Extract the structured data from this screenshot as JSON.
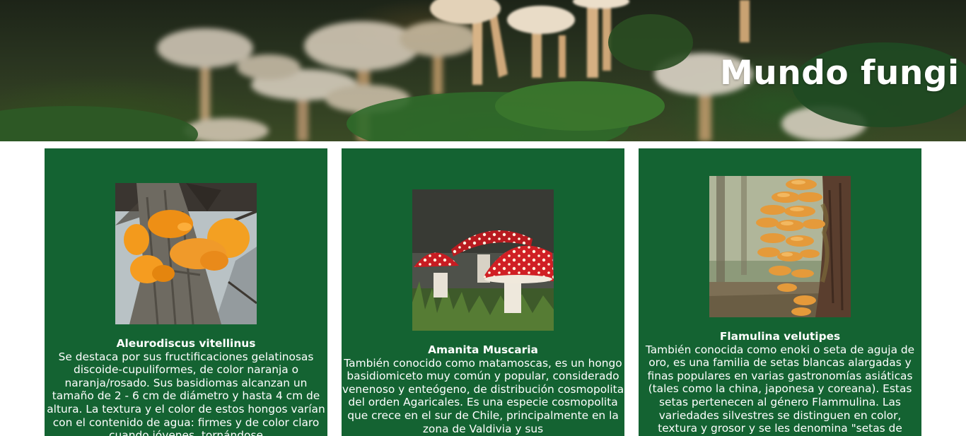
{
  "header": {
    "title": "Mundo fungi",
    "background_icon": "mushroom-forest-photo"
  },
  "colors": {
    "card_background": "#146332",
    "card_text": "#ffffff",
    "page_background": "#ffffff"
  },
  "cards": [
    {
      "title": "Aleurodiscus vitellinus",
      "image_icon": "orange-jelly-fungus-photo",
      "description": "Se destaca por sus fructificaciones gelatinosas discoide-cupuliformes, de color naranja o naranja/rosado. Sus basidiomas alcanzan un tamaño de 2 - 6 cm de diámetro y hasta 4 cm de altura. La textura y el color de estos hongos varían con el contenido de agua: firmes y de color claro cuando jóvenes, tornándose"
    },
    {
      "title": "Amanita Muscaria",
      "image_icon": "red-spotted-mushroom-photo",
      "description": "También conocido como matamoscas, es un hongo basidiomiceto muy común y popular, considerado venenoso y enteógeno, de distribución cosmopolita del orden Agaricales. Es una especie cosmopolita que crece en el sur de Chile, principalmente en la zona de Valdivia y sus"
    },
    {
      "title": "Flamulina velutipes",
      "image_icon": "enoki-cluster-photo",
      "description": "También conocida como enoki o seta de aguja de oro, es una familia de setas blancas alargadas y finas populares en varias gastronomías asiáticas (tales como la china, japonesa y coreana). Estas setas pertenecen al género Flammulina. Las variedades silvestres se distinguen en color, textura y grosor y se les denomina \"setas de"
    }
  ]
}
